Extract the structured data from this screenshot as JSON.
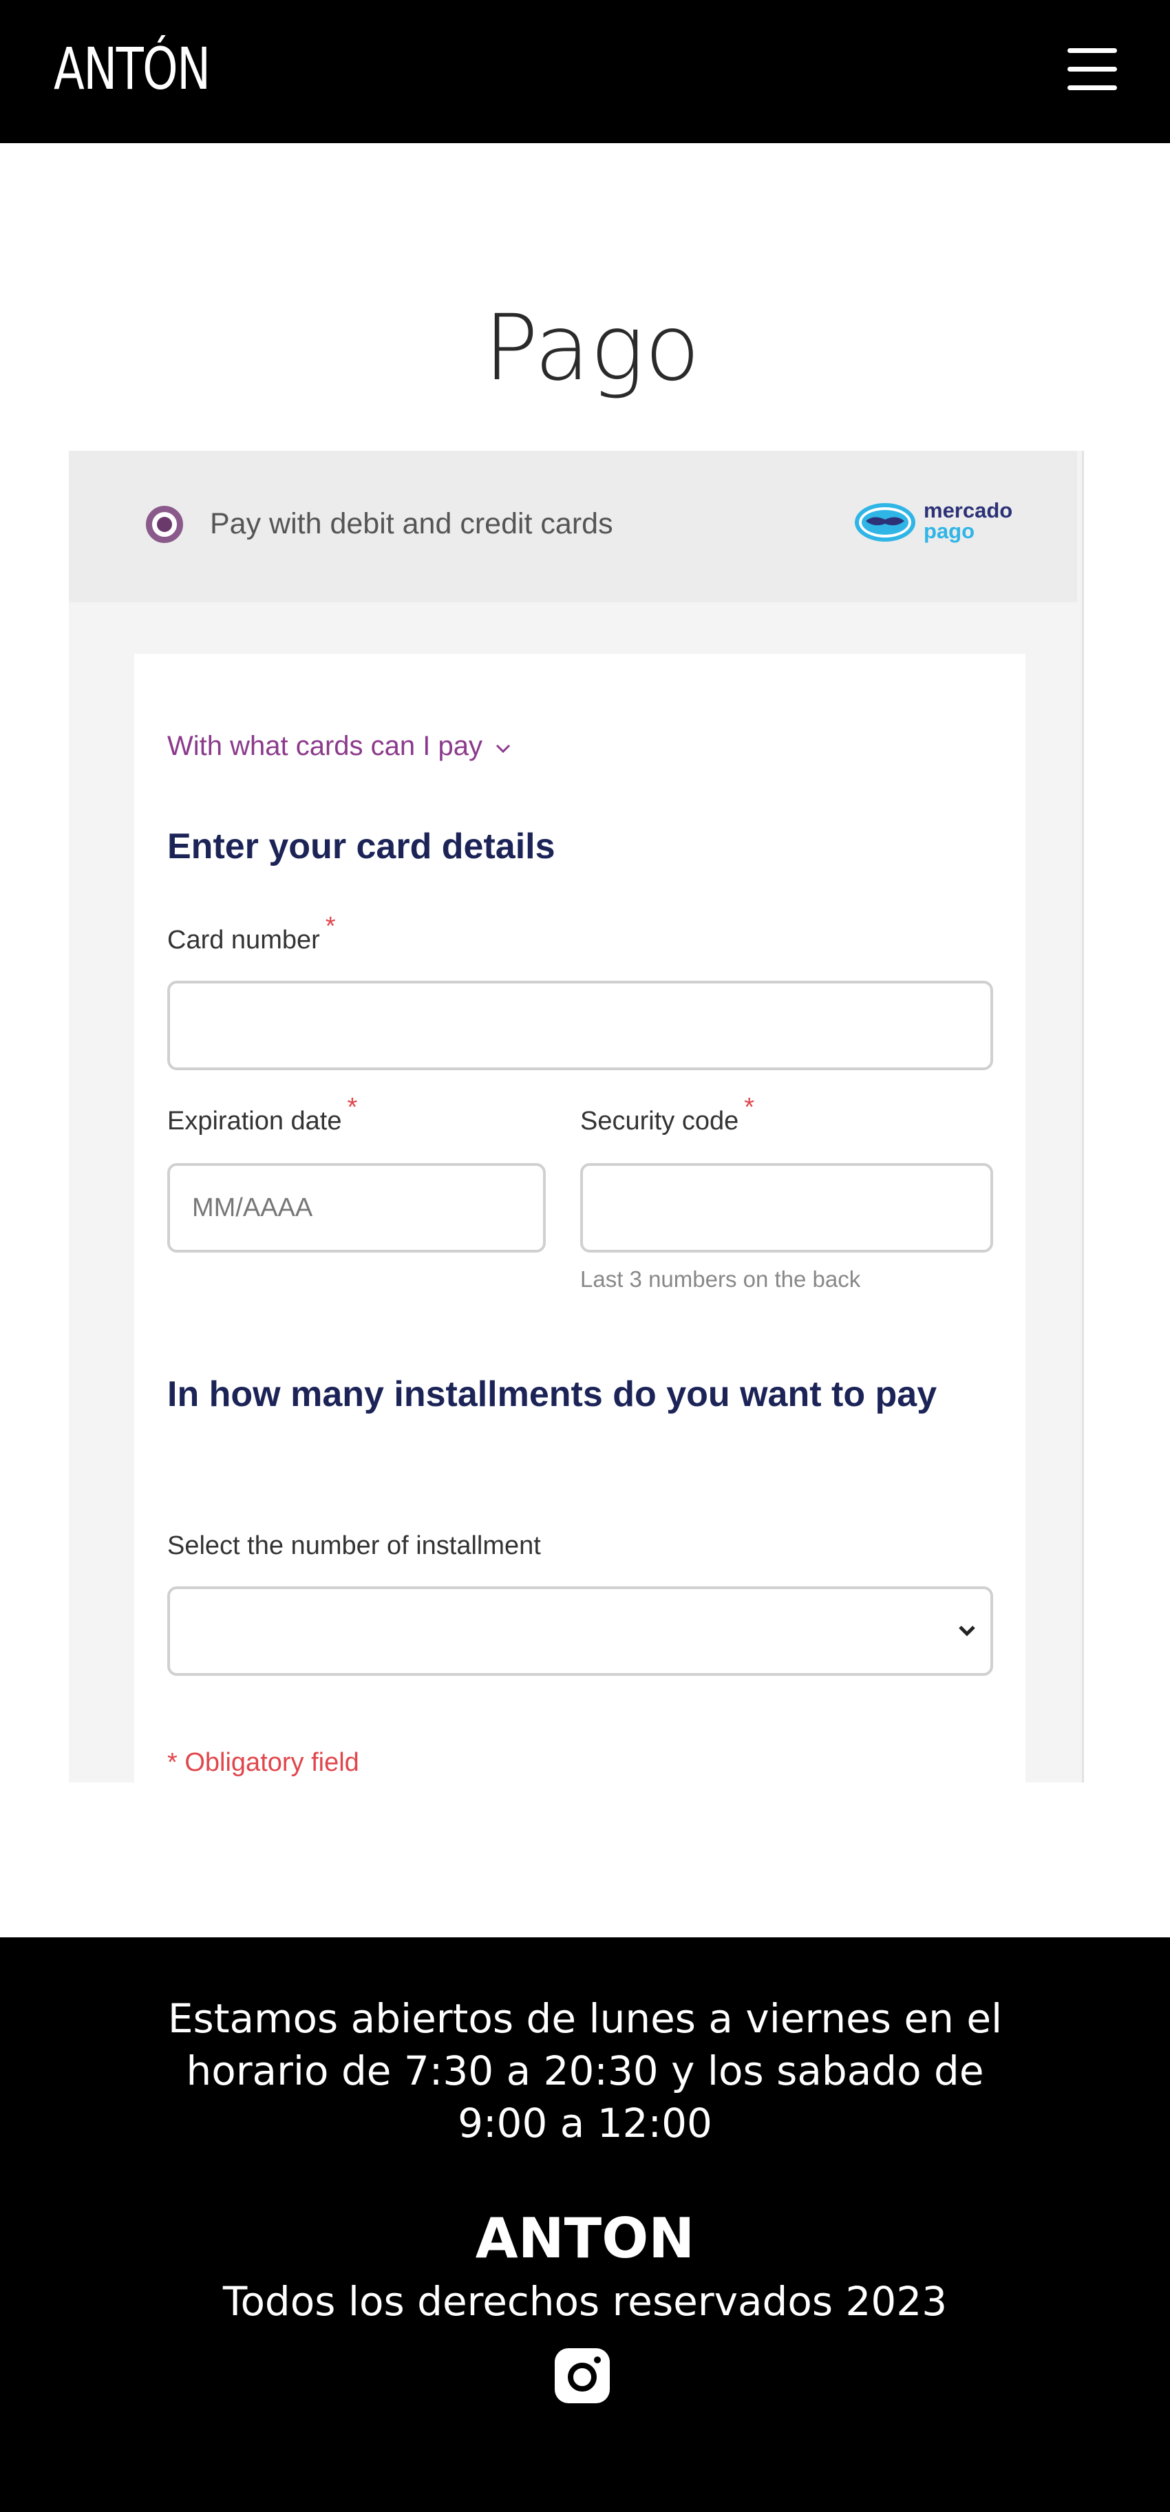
{
  "header": {
    "logo": "ANTÓN",
    "menu_icon": "hamburger-menu-icon"
  },
  "page": {
    "title": "Pago"
  },
  "payment": {
    "option_label": "Pay with debit and credit cards",
    "provider_logo_top": "mercado",
    "provider_logo_bottom": "pago",
    "cards_link": "With what cards can I pay",
    "details_heading": "Enter your card details",
    "card_number_label": "Card number",
    "expiration_label": "Expiration date",
    "expiration_placeholder": "MM/AAAA",
    "security_label": "Security code",
    "security_hint": "Last 3 numbers on the back",
    "required_mark": "*",
    "installments_heading": "In how many installments do you want to pay",
    "installments_label": "Select the number of installment",
    "obligatory_note": "* Obligatory field",
    "colors": {
      "accent_purple": "#8b3a8b",
      "heading_navy": "#1c2457",
      "required_red": "#e0464b"
    }
  },
  "footer": {
    "hours": "Estamos abiertos de lunes a viernes en el horario de 7:30 a 20:30 y los sabado de 9:00 a 12:00",
    "brand": "ANTON",
    "rights": "Todos los derechos reservados 2023",
    "social_icon": "instagram-icon"
  }
}
